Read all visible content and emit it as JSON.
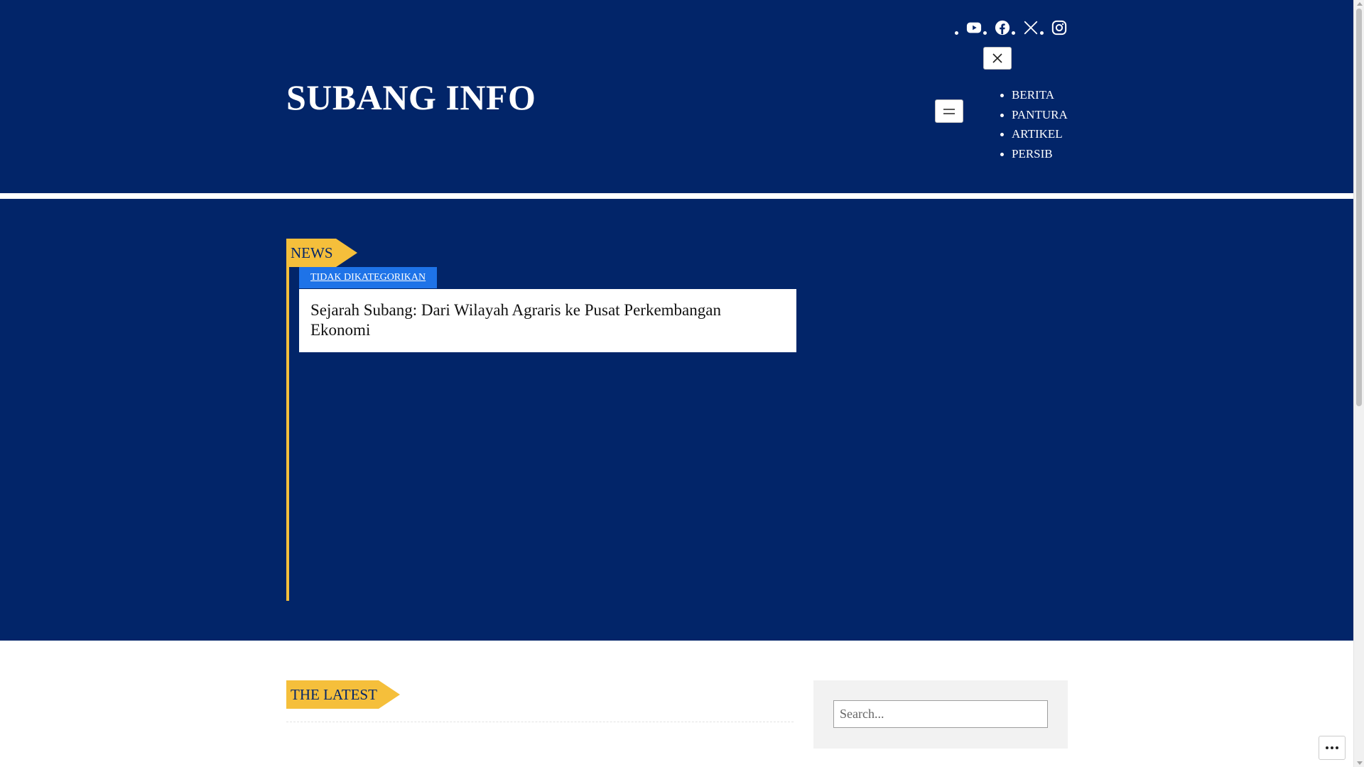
{
  "site": {
    "title": "SUBANG INFO"
  },
  "social": [
    {
      "name": "youtube-icon"
    },
    {
      "name": "facebook-icon"
    },
    {
      "name": "x-icon"
    },
    {
      "name": "instagram-icon"
    }
  ],
  "nav": {
    "items": [
      "BERITA",
      "PANTURA",
      "ARTIKEL",
      "PERSIB"
    ]
  },
  "hero": {
    "section_label": "NEWS",
    "category": "TIDAK DIKATEGORIKAN",
    "post_title": "Sejarah Subang: Dari Wilayah Agraris ke Pusat Perkembangan Ekonomi"
  },
  "latest": {
    "section_label": "THE LATEST"
  },
  "sidebar": {
    "search_placeholder": "Search..."
  },
  "colors": {
    "navy": "#022569",
    "accent_yellow": "#f5bf3b",
    "badge_blue": "#1e73e8"
  }
}
